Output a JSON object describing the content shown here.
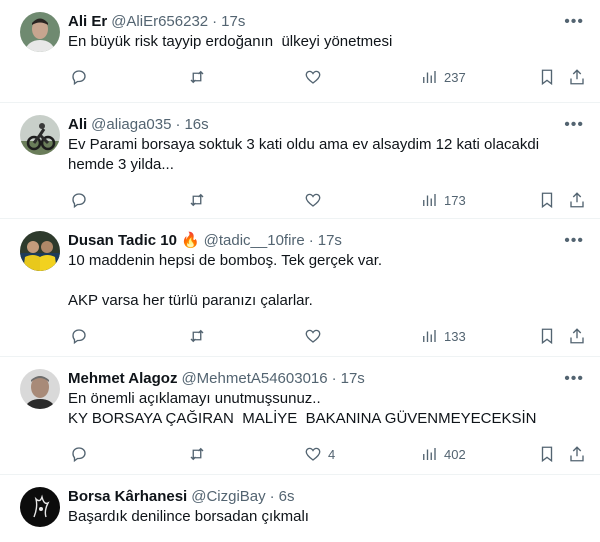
{
  "tweets": [
    {
      "name": "Ali Er",
      "handle": "@AliEr656232",
      "dot": "·",
      "time": "17s",
      "text": "En büyük risk tayyip erdoğanın  ülkeyi yönetmesi",
      "likes": "",
      "views": "237"
    },
    {
      "name": "Ali",
      "handle": "@aliaga035",
      "dot": "·",
      "time": "16s",
      "text": "Ev Parami borsaya soktuk 3 kati oldu ama ev alsaydim 12 kati olacakdi\nhemde 3 yilda...",
      "likes": "",
      "views": "173"
    },
    {
      "name": "Dusan Tadic 10",
      "handle": "@tadic__10fire",
      "dot": "·",
      "time": "17s",
      "text": "10 maddenin hepsi de bomboş. Tek gerçek var.\n\nAKP varsa her türlü paranızı çalarlar.",
      "likes": "",
      "views": "133"
    },
    {
      "name": "Mehmet Alagoz",
      "handle": "@MehmetA54603016",
      "dot": "·",
      "time": "17s",
      "text": "En önemli açıklamayı unutmuşsunuz..\nKY BORSAYA ÇAĞIRAN  MALİYE  BAKANINA GÜVENMEYECEKSİN",
      "likes": "4",
      "views": "402"
    },
    {
      "name": "Borsa Kârhanesi",
      "handle": "@CizgiBay",
      "dot": "·",
      "time": "6s",
      "text": "Başardık denilince borsadan çıkmalı"
    }
  ]
}
